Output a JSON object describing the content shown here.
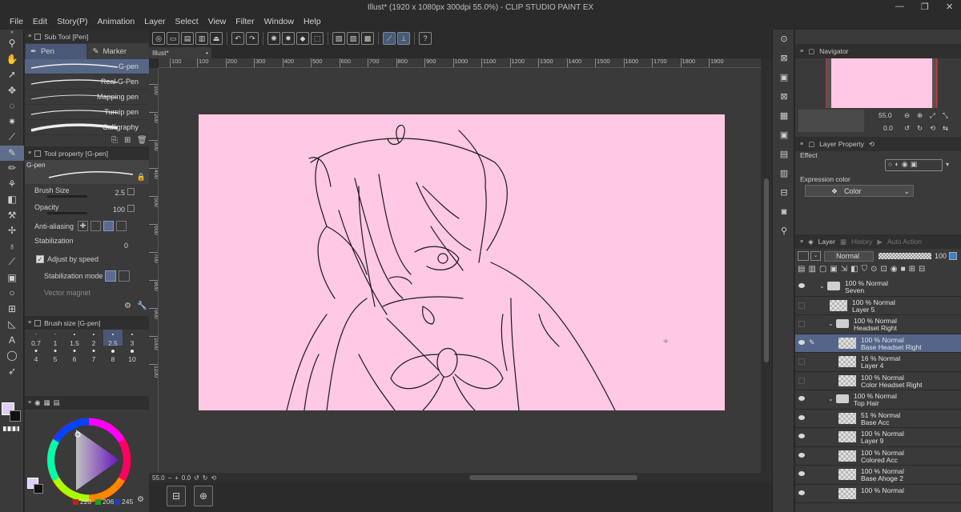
{
  "window": {
    "title": "Illust* (1920 x 1080px 300dpi 55.0%)  - CLIP STUDIO PAINT EX",
    "minimize": "—",
    "maximize": "❐",
    "close": "✕"
  },
  "menu": [
    "File",
    "Edit",
    "Story(P)",
    "Animation",
    "Layer",
    "Select",
    "View",
    "Filter",
    "Window",
    "Help"
  ],
  "sub_tool": {
    "header": "Sub Tool [Pen]",
    "tabs": [
      "Pen",
      "Marker"
    ],
    "brushes": [
      "G-pen",
      "Real G-Pen",
      "Mapping pen",
      "Turnip pen",
      "Calligraphy"
    ]
  },
  "tool_property": {
    "header": "Tool property [G-pen]",
    "preview_label": "G-pen",
    "brush_size_label": "Brush Size",
    "brush_size_value": "2.5",
    "opacity_label": "Opacity",
    "opacity_value": "100",
    "anti_aliasing_label": "Anti-aliasing",
    "stabilization_label": "Stabilization",
    "stabilization_value": "0",
    "adjust_by_speed_label": "Adjust by speed",
    "stabilization_mode_label": "Stabilization mode",
    "vector_magnet_label": "Vector magnet"
  },
  "brush_size": {
    "header": "Brush size [G-pen]",
    "values": [
      "0.7",
      "1",
      "1.5",
      "2",
      "2.5",
      "3",
      "4",
      "5",
      "6",
      "7",
      "8",
      "10"
    ],
    "selected": "2.5"
  },
  "color": {
    "main": "#dfcef5",
    "sub": "#111111",
    "r": "223",
    "g": "206",
    "b": "245"
  },
  "document_tab": "Illust*",
  "ruler_marks": [
    "100",
    "100",
    "200",
    "300",
    "400",
    "500",
    "600",
    "700",
    "800",
    "900",
    "1000",
    "1100",
    "1200",
    "1300",
    "1400",
    "1500",
    "1600",
    "1700",
    "1800",
    "1900"
  ],
  "vruler_marks": [
    "100",
    "200",
    "300",
    "400",
    "500",
    "600",
    "700",
    "800",
    "900",
    "1000",
    "1100"
  ],
  "canvas": {
    "background": "#ffc8e4"
  },
  "status": {
    "zoom": "55.0",
    "angle": "0.0"
  },
  "navigator": {
    "header": "Navigator",
    "zoom": "55.0",
    "angle": "0.0"
  },
  "layer_property": {
    "header": "Layer Property",
    "effect_label": "Effect",
    "expression_color_label": "Expression color",
    "expression_color_value": "Color"
  },
  "layer_panel": {
    "tabs": [
      "Layer",
      "History",
      "Auto Action"
    ],
    "blend_mode": "Normal",
    "opacity": "100",
    "layers": [
      {
        "blend": "100 % Normal",
        "name": "Seven",
        "type": "folder",
        "indent": 0,
        "visible": true,
        "selected": false
      },
      {
        "blend": "100 % Normal",
        "name": "Layer 5",
        "type": "raster",
        "indent": 1,
        "visible": false,
        "selected": false
      },
      {
        "blend": "100 % Normal",
        "name": "Headset Right",
        "type": "folder",
        "indent": 1,
        "visible": false,
        "selected": false
      },
      {
        "blend": "100 % Normal",
        "name": "Base Headset Right",
        "type": "raster",
        "indent": 2,
        "visible": true,
        "selected": true
      },
      {
        "blend": "16 % Normal",
        "name": "Layer 4",
        "type": "raster",
        "indent": 2,
        "visible": false,
        "selected": false
      },
      {
        "blend": "100 % Normal",
        "name": "Color Headset Right",
        "type": "raster",
        "indent": 2,
        "visible": false,
        "selected": false
      },
      {
        "blend": "100 % Normal",
        "name": "Top Hair",
        "type": "folder",
        "indent": 1,
        "visible": true,
        "selected": false
      },
      {
        "blend": "51 % Normal",
        "name": "Base Acc",
        "type": "raster",
        "indent": 2,
        "visible": true,
        "selected": false
      },
      {
        "blend": "100 % Normal",
        "name": "Layer 9",
        "type": "raster",
        "indent": 2,
        "visible": true,
        "selected": false
      },
      {
        "blend": "100 % Normal",
        "name": "Colored Acc",
        "type": "raster",
        "indent": 2,
        "visible": true,
        "selected": false
      },
      {
        "blend": "100 % Normal",
        "name": "Base Ahoge 2",
        "type": "raster",
        "indent": 2,
        "visible": true,
        "selected": false
      },
      {
        "blend": "100 % Normal",
        "name": "",
        "type": "raster",
        "indent": 2,
        "visible": true,
        "selected": false
      }
    ]
  }
}
